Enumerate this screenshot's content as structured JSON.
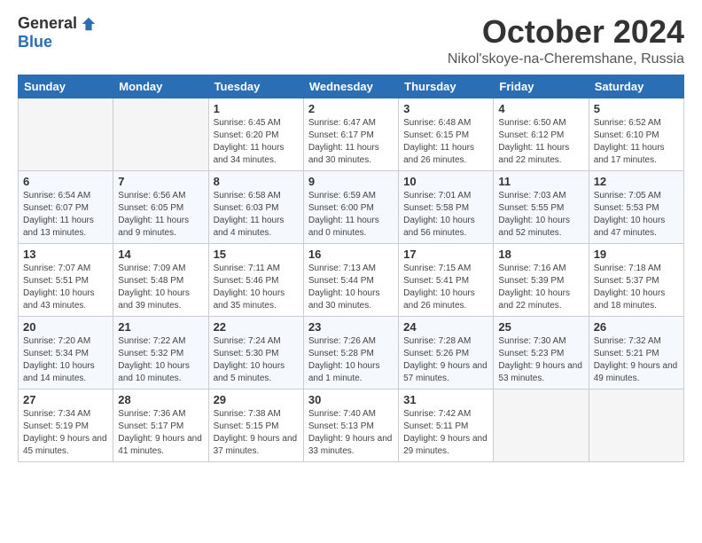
{
  "header": {
    "logo_general": "General",
    "logo_blue": "Blue",
    "month": "October 2024",
    "location": "Nikol'skoye-na-Cheremshane, Russia"
  },
  "weekdays": [
    "Sunday",
    "Monday",
    "Tuesday",
    "Wednesday",
    "Thursday",
    "Friday",
    "Saturday"
  ],
  "weeks": [
    [
      {
        "day": "",
        "sunrise": "",
        "sunset": "",
        "daylight": ""
      },
      {
        "day": "",
        "sunrise": "",
        "sunset": "",
        "daylight": ""
      },
      {
        "day": "1",
        "sunrise": "Sunrise: 6:45 AM",
        "sunset": "Sunset: 6:20 PM",
        "daylight": "Daylight: 11 hours and 34 minutes."
      },
      {
        "day": "2",
        "sunrise": "Sunrise: 6:47 AM",
        "sunset": "Sunset: 6:17 PM",
        "daylight": "Daylight: 11 hours and 30 minutes."
      },
      {
        "day": "3",
        "sunrise": "Sunrise: 6:48 AM",
        "sunset": "Sunset: 6:15 PM",
        "daylight": "Daylight: 11 hours and 26 minutes."
      },
      {
        "day": "4",
        "sunrise": "Sunrise: 6:50 AM",
        "sunset": "Sunset: 6:12 PM",
        "daylight": "Daylight: 11 hours and 22 minutes."
      },
      {
        "day": "5",
        "sunrise": "Sunrise: 6:52 AM",
        "sunset": "Sunset: 6:10 PM",
        "daylight": "Daylight: 11 hours and 17 minutes."
      }
    ],
    [
      {
        "day": "6",
        "sunrise": "Sunrise: 6:54 AM",
        "sunset": "Sunset: 6:07 PM",
        "daylight": "Daylight: 11 hours and 13 minutes."
      },
      {
        "day": "7",
        "sunrise": "Sunrise: 6:56 AM",
        "sunset": "Sunset: 6:05 PM",
        "daylight": "Daylight: 11 hours and 9 minutes."
      },
      {
        "day": "8",
        "sunrise": "Sunrise: 6:58 AM",
        "sunset": "Sunset: 6:03 PM",
        "daylight": "Daylight: 11 hours and 4 minutes."
      },
      {
        "day": "9",
        "sunrise": "Sunrise: 6:59 AM",
        "sunset": "Sunset: 6:00 PM",
        "daylight": "Daylight: 11 hours and 0 minutes."
      },
      {
        "day": "10",
        "sunrise": "Sunrise: 7:01 AM",
        "sunset": "Sunset: 5:58 PM",
        "daylight": "Daylight: 10 hours and 56 minutes."
      },
      {
        "day": "11",
        "sunrise": "Sunrise: 7:03 AM",
        "sunset": "Sunset: 5:55 PM",
        "daylight": "Daylight: 10 hours and 52 minutes."
      },
      {
        "day": "12",
        "sunrise": "Sunrise: 7:05 AM",
        "sunset": "Sunset: 5:53 PM",
        "daylight": "Daylight: 10 hours and 47 minutes."
      }
    ],
    [
      {
        "day": "13",
        "sunrise": "Sunrise: 7:07 AM",
        "sunset": "Sunset: 5:51 PM",
        "daylight": "Daylight: 10 hours and 43 minutes."
      },
      {
        "day": "14",
        "sunrise": "Sunrise: 7:09 AM",
        "sunset": "Sunset: 5:48 PM",
        "daylight": "Daylight: 10 hours and 39 minutes."
      },
      {
        "day": "15",
        "sunrise": "Sunrise: 7:11 AM",
        "sunset": "Sunset: 5:46 PM",
        "daylight": "Daylight: 10 hours and 35 minutes."
      },
      {
        "day": "16",
        "sunrise": "Sunrise: 7:13 AM",
        "sunset": "Sunset: 5:44 PM",
        "daylight": "Daylight: 10 hours and 30 minutes."
      },
      {
        "day": "17",
        "sunrise": "Sunrise: 7:15 AM",
        "sunset": "Sunset: 5:41 PM",
        "daylight": "Daylight: 10 hours and 26 minutes."
      },
      {
        "day": "18",
        "sunrise": "Sunrise: 7:16 AM",
        "sunset": "Sunset: 5:39 PM",
        "daylight": "Daylight: 10 hours and 22 minutes."
      },
      {
        "day": "19",
        "sunrise": "Sunrise: 7:18 AM",
        "sunset": "Sunset: 5:37 PM",
        "daylight": "Daylight: 10 hours and 18 minutes."
      }
    ],
    [
      {
        "day": "20",
        "sunrise": "Sunrise: 7:20 AM",
        "sunset": "Sunset: 5:34 PM",
        "daylight": "Daylight: 10 hours and 14 minutes."
      },
      {
        "day": "21",
        "sunrise": "Sunrise: 7:22 AM",
        "sunset": "Sunset: 5:32 PM",
        "daylight": "Daylight: 10 hours and 10 minutes."
      },
      {
        "day": "22",
        "sunrise": "Sunrise: 7:24 AM",
        "sunset": "Sunset: 5:30 PM",
        "daylight": "Daylight: 10 hours and 5 minutes."
      },
      {
        "day": "23",
        "sunrise": "Sunrise: 7:26 AM",
        "sunset": "Sunset: 5:28 PM",
        "daylight": "Daylight: 10 hours and 1 minute."
      },
      {
        "day": "24",
        "sunrise": "Sunrise: 7:28 AM",
        "sunset": "Sunset: 5:26 PM",
        "daylight": "Daylight: 9 hours and 57 minutes."
      },
      {
        "day": "25",
        "sunrise": "Sunrise: 7:30 AM",
        "sunset": "Sunset: 5:23 PM",
        "daylight": "Daylight: 9 hours and 53 minutes."
      },
      {
        "day": "26",
        "sunrise": "Sunrise: 7:32 AM",
        "sunset": "Sunset: 5:21 PM",
        "daylight": "Daylight: 9 hours and 49 minutes."
      }
    ],
    [
      {
        "day": "27",
        "sunrise": "Sunrise: 7:34 AM",
        "sunset": "Sunset: 5:19 PM",
        "daylight": "Daylight: 9 hours and 45 minutes."
      },
      {
        "day": "28",
        "sunrise": "Sunrise: 7:36 AM",
        "sunset": "Sunset: 5:17 PM",
        "daylight": "Daylight: 9 hours and 41 minutes."
      },
      {
        "day": "29",
        "sunrise": "Sunrise: 7:38 AM",
        "sunset": "Sunset: 5:15 PM",
        "daylight": "Daylight: 9 hours and 37 minutes."
      },
      {
        "day": "30",
        "sunrise": "Sunrise: 7:40 AM",
        "sunset": "Sunset: 5:13 PM",
        "daylight": "Daylight: 9 hours and 33 minutes."
      },
      {
        "day": "31",
        "sunrise": "Sunrise: 7:42 AM",
        "sunset": "Sunset: 5:11 PM",
        "daylight": "Daylight: 9 hours and 29 minutes."
      },
      {
        "day": "",
        "sunrise": "",
        "sunset": "",
        "daylight": ""
      },
      {
        "day": "",
        "sunrise": "",
        "sunset": "",
        "daylight": ""
      }
    ]
  ]
}
